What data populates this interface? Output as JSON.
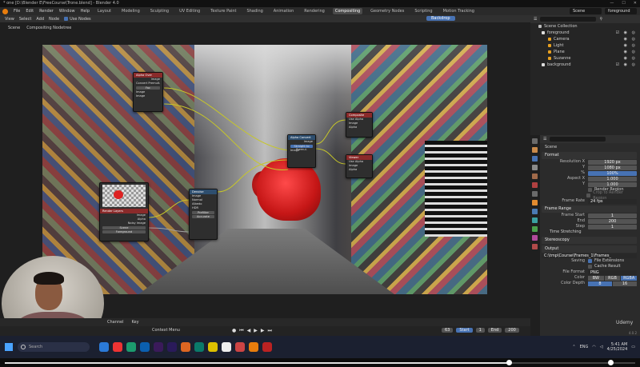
{
  "window": {
    "title": "* one [D:\\Blender E\\FreeCourse\\Trone.blend] - Blender 4.0",
    "controls": [
      "—",
      "☐",
      "✕"
    ]
  },
  "topbar": {
    "menus": [
      "File",
      "Edit",
      "Render",
      "Window",
      "Help"
    ],
    "workspaces": [
      "Layout",
      "Modeling",
      "Sculpting",
      "UV Editing",
      "Texture Paint",
      "Shading",
      "Animation",
      "Rendering",
      "Compositing",
      "Geometry Nodes",
      "Scripting",
      "Motion Tracking"
    ],
    "active_workspace": "Compositing",
    "scene_field": "Scene",
    "viewlayer_field": "foreground"
  },
  "node_header": {
    "menus": [
      "View",
      "Select",
      "Add",
      "Node"
    ],
    "use_nodes_label": "Use Nodes",
    "backdrop_label": "Backdrop"
  },
  "breadcrumb": {
    "scene": "Scene",
    "tree": "Compositing Nodetree"
  },
  "nodes": {
    "alpha_over": {
      "title": "Alpha Over",
      "rows": [
        "Image",
        "Convert Premult.",
        "Fac",
        "Image",
        "Image"
      ]
    },
    "composite": {
      "title": "Composite",
      "rows": [
        "Use Alpha",
        "Image",
        "Alpha"
      ]
    },
    "viewer": {
      "title": "Viewer",
      "rows": [
        "Use Alpha",
        "Image",
        "Alpha"
      ]
    },
    "alpha_convert": {
      "title": "Alpha Convert",
      "rows": [
        "Image",
        "Image"
      ],
      "mode": "Straight to Premul."
    },
    "render_layers": {
      "title": "Render Layers",
      "rows": [
        "Image",
        "Alpha",
        "Noisy Image"
      ],
      "scene": "Scene",
      "layer": "Foreground"
    },
    "color_ramp": {
      "title": "Denoise",
      "rows": [
        "Image",
        "Normal",
        "Albedo",
        "HDR"
      ],
      "fields": [
        "Prefilter",
        "Accurate"
      ]
    }
  },
  "timeline": {
    "menus": [
      "Channel",
      "Key"
    ],
    "context_menu": "Context Menu",
    "current_frame": "63",
    "start_label": "Start",
    "start": "1",
    "end_label": "End",
    "end": "200"
  },
  "outliner": {
    "items": [
      {
        "label": "Scene Collection",
        "indent": 0
      },
      {
        "label": "foreground",
        "indent": 1
      },
      {
        "label": "Camera",
        "indent": 2
      },
      {
        "label": "Light",
        "indent": 2
      },
      {
        "label": "Plane",
        "indent": 2
      },
      {
        "label": "Suzanne",
        "indent": 2
      },
      {
        "label": "background",
        "indent": 1
      }
    ]
  },
  "properties": {
    "header": "Scene",
    "format_section": "Format",
    "resolution_x_label": "Resolution X",
    "resolution_x": "1920 px",
    "resolution_y_label": "Y",
    "resolution_y": "1080 px",
    "resolution_pct_label": "%",
    "resolution_pct": "100%",
    "aspect_x_label": "Aspect X",
    "aspect_x": "1.000",
    "aspect_y_label": "Y",
    "aspect_y": "1.000",
    "render_region": "Render Region",
    "crop_region": "Crop to Render Region",
    "frame_rate_label": "Frame Rate",
    "frame_rate": "24 fps",
    "frame_range_section": "Frame Range",
    "frame_start_label": "Frame Start",
    "frame_start": "1",
    "frame_end_label": "End",
    "frame_end": "200",
    "frame_step_label": "Step",
    "frame_step": "1",
    "time_stretching": "Time Stretching",
    "stereoscopy": "Stereoscopy",
    "output_section": "Output",
    "output_path": "C:\\tmp\\Course\\Frames_1\\Frames_",
    "saving_label": "Saving",
    "file_extensions": "File Extensions",
    "cache_result": "Cache Result",
    "file_format_label": "File Format",
    "file_format": "PNG",
    "color_label": "Color",
    "color_options": [
      "BW",
      "RGB",
      "RGBA"
    ],
    "color_active": "RGBA",
    "color_depth_label": "Color Depth",
    "color_depth_options": [
      "8",
      "16"
    ],
    "version": "4.0.2"
  },
  "taskbar": {
    "search_placeholder": "Search",
    "language": "ENG",
    "time": "5:41 AM",
    "date": "4/25/2024"
  },
  "watermark": "Udemy",
  "colors": {
    "accent": "#4772b3",
    "blender_orange": "#e87d0d",
    "node_header_red": "#8a2a2a",
    "node_header_blue": "#2e4e6e"
  }
}
